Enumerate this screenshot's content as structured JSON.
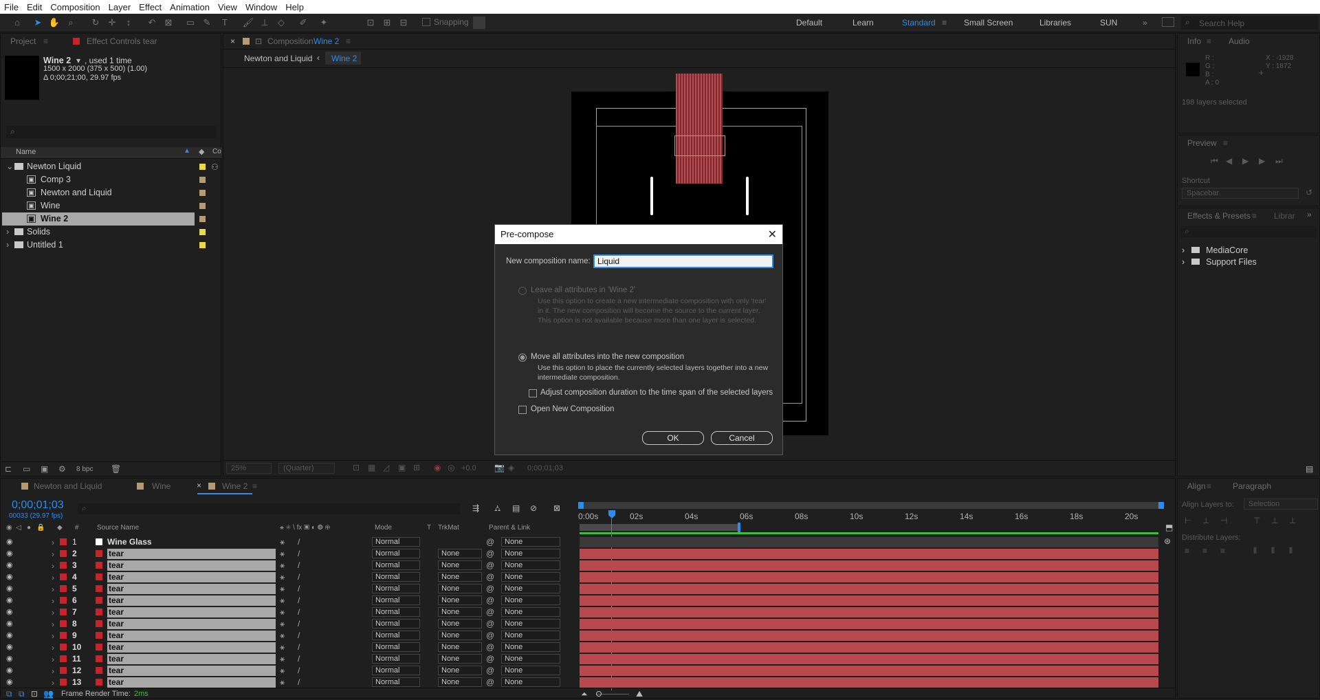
{
  "menu": [
    "File",
    "Edit",
    "Composition",
    "Layer",
    "Effect",
    "Animation",
    "View",
    "Window",
    "Help"
  ],
  "toolbar": {
    "snapping": "Snapping"
  },
  "workspaces": [
    "Default",
    "Learn",
    "Standard",
    "Small Screen",
    "Libraries",
    "SUN"
  ],
  "search_help": "Search Help",
  "project": {
    "tab_project": "Project",
    "tab_effect_controls": "Effect Controls tear",
    "item_name": "Wine 2",
    "used": ", used 1 time",
    "dims": "1500 x 2000  (375 x 500) (1.00)",
    "duration": "Δ 0;00;21;00, 29.97 fps",
    "col_name": "Name",
    "bpc": "8 bpc",
    "items": [
      {
        "label": "Newton Liquid",
        "type": "folder",
        "color": "#e8d84a"
      },
      {
        "label": "Comp 3",
        "type": "comp",
        "color": "#b59b73"
      },
      {
        "label": "Newton and Liquid",
        "type": "comp",
        "color": "#b59b73"
      },
      {
        "label": "Wine",
        "type": "comp",
        "color": "#b59b73"
      },
      {
        "label": "Wine 2",
        "type": "comp",
        "color": "#b59b73"
      },
      {
        "label": "Solids",
        "type": "folder",
        "color": "#e8d84a"
      },
      {
        "label": "Untitled 1",
        "type": "folder",
        "color": "#e8d84a"
      }
    ]
  },
  "composition": {
    "tab_label": "Composition",
    "tab_name": "Wine 2",
    "crumb1": "Newton and Liquid",
    "crumb2": "Wine 2",
    "zoom": "25%",
    "resolution": "(Quarter)",
    "exposure": "+0.0",
    "timecode": "0;00;01;03"
  },
  "info": {
    "tab_info": "Info",
    "tab_audio": "Audio",
    "r": "R :",
    "g": "G :",
    "b": "B :",
    "a": "A :  0",
    "x": "X : -1928",
    "y": "Y : 1872",
    "layers_selected": "198 layers selected"
  },
  "preview": {
    "title": "Preview",
    "shortcut_label": "Shortcut",
    "shortcut_value": "Spacebar"
  },
  "effects": {
    "tab": "Effects & Presets",
    "tab2": "Librar",
    "items": [
      "MediaCore",
      "Support Files"
    ]
  },
  "align": {
    "tab": "Align",
    "tab2": "Paragraph",
    "align_to_label": "Align Layers to:",
    "align_to_value": "Selection",
    "distribute": "Distribute Layers:"
  },
  "timeline": {
    "tabs": [
      "Newton and Liquid",
      "Wine",
      "Wine 2"
    ],
    "timecode": "0;00;01;03",
    "frames": "00033 (29.97 fps)",
    "col_source": "Source Name",
    "col_mode": "Mode",
    "col_t": "T",
    "col_trkmat": "TrkMat",
    "col_parent": "Parent & Link",
    "ruler": [
      "0:00s",
      "02s",
      "04s",
      "06s",
      "08s",
      "10s",
      "12s",
      "14s",
      "16s",
      "18s",
      "20s"
    ],
    "layers": [
      {
        "num": "1",
        "name": "Wine Glass",
        "mode": "Normal",
        "trkmat": "",
        "parent": "None",
        "label_color": "#ffffff"
      },
      {
        "num": "2",
        "name": "tear",
        "mode": "Normal",
        "trkmat": "None",
        "parent": "None",
        "label_color": "#c8232c"
      },
      {
        "num": "3",
        "name": "tear",
        "mode": "Normal",
        "trkmat": "None",
        "parent": "None",
        "label_color": "#c8232c"
      },
      {
        "num": "4",
        "name": "tear",
        "mode": "Normal",
        "trkmat": "None",
        "parent": "None",
        "label_color": "#c8232c"
      },
      {
        "num": "5",
        "name": "tear",
        "mode": "Normal",
        "trkmat": "None",
        "parent": "None",
        "label_color": "#c8232c"
      },
      {
        "num": "6",
        "name": "tear",
        "mode": "Normal",
        "trkmat": "None",
        "parent": "None",
        "label_color": "#c8232c"
      },
      {
        "num": "7",
        "name": "tear",
        "mode": "Normal",
        "trkmat": "None",
        "parent": "None",
        "label_color": "#c8232c"
      },
      {
        "num": "8",
        "name": "tear",
        "mode": "Normal",
        "trkmat": "None",
        "parent": "None",
        "label_color": "#c8232c"
      },
      {
        "num": "9",
        "name": "tear",
        "mode": "Normal",
        "trkmat": "None",
        "parent": "None",
        "label_color": "#c8232c"
      },
      {
        "num": "10",
        "name": "tear",
        "mode": "Normal",
        "trkmat": "None",
        "parent": "None",
        "label_color": "#c8232c"
      },
      {
        "num": "11",
        "name": "tear",
        "mode": "Normal",
        "trkmat": "None",
        "parent": "None",
        "label_color": "#c8232c"
      },
      {
        "num": "12",
        "name": "tear",
        "mode": "Normal",
        "trkmat": "None",
        "parent": "None",
        "label_color": "#c8232c"
      },
      {
        "num": "13",
        "name": "tear",
        "mode": "Normal",
        "trkmat": "None",
        "parent": "None",
        "label_color": "#c8232c"
      }
    ],
    "frame_render_label": "Frame Render Time:",
    "frame_render_value": "2ms"
  },
  "dialog": {
    "title": "Pre-compose",
    "name_label": "New composition name:",
    "name_value": "Liquid",
    "opt1": "Leave all attributes in 'Wine 2'",
    "opt1_desc": "Use this option to create a new intermediate composition with only 'tear' in it. The new composition will become the source to the current layer. This option is not available because more than one layer is selected.",
    "opt2": "Move all attributes into the new composition",
    "opt2_desc": "Use this option to place the currently selected layers together into a new intermediate composition.",
    "adjust": "Adjust composition duration to the time span of the selected layers",
    "open_new": "Open New Composition",
    "ok": "OK",
    "cancel": "Cancel"
  },
  "colors": {
    "accent": "#2d8ceb",
    "layer_bar": "#b8494f",
    "selection": "#a8a8a8"
  }
}
